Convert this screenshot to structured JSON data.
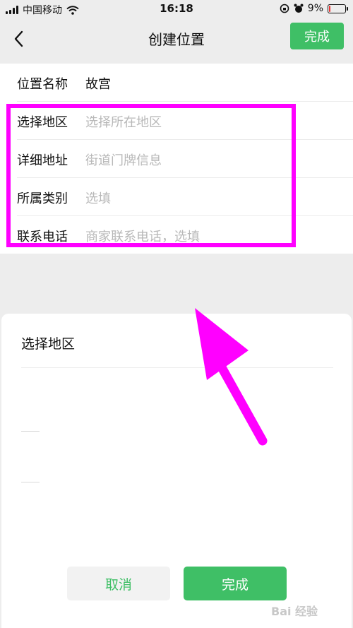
{
  "status_bar": {
    "carrier": "中国移动",
    "time": "16:18",
    "battery": "9%",
    "battery_level": 0.09
  },
  "nav": {
    "title": "创建位置",
    "done_label": "完成",
    "back_icon": "chevron-left-icon"
  },
  "form": {
    "rows": [
      {
        "label": "位置名称",
        "value": "故宫"
      },
      {
        "label": "选择地区",
        "placeholder": "选择所在地区"
      },
      {
        "label": "详细地址",
        "placeholder": "街道门牌信息"
      },
      {
        "label": "所属类别",
        "placeholder": "选填"
      },
      {
        "label": "联系电话",
        "placeholder": "商家联系电话，选填"
      }
    ]
  },
  "sheet": {
    "title": "选择地区",
    "cancel_label": "取消",
    "done_label": "完成"
  },
  "watermark": {
    "baidu": "Bai 经验"
  },
  "colors": {
    "accent": "#3fbf66",
    "highlight": "#ff00ff",
    "background": "#ededed"
  }
}
